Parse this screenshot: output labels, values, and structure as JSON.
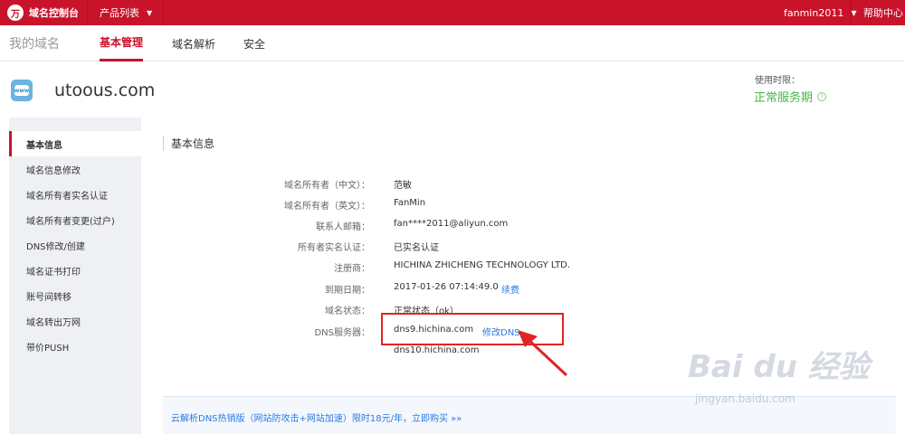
{
  "topbar": {
    "logo_text": "域名控制台",
    "products_label": "产品列表",
    "username": "fanmin2011",
    "help_label": "帮助中心"
  },
  "nav": {
    "title": "我的域名",
    "tabs": [
      {
        "label": "基本管理",
        "active": true
      },
      {
        "label": "域名解析",
        "active": false
      },
      {
        "label": "安全",
        "active": false
      }
    ]
  },
  "domain": {
    "icon_label": "www",
    "name": "utoous.com",
    "term_label": "使用时限：",
    "term_status": "正常服务期",
    "term_help": "?"
  },
  "sidebar": {
    "items": [
      {
        "label": "基本信息",
        "active": true
      },
      {
        "label": "域名信息修改"
      },
      {
        "label": "域名所有者实名认证"
      },
      {
        "label": "域名所有者变更(过户)"
      },
      {
        "label": "DNS修改/创建"
      },
      {
        "label": "域名证书打印"
      },
      {
        "label": "账号间转移"
      },
      {
        "label": "域名转出万网"
      },
      {
        "label": "带价PUSH"
      }
    ]
  },
  "info": {
    "section_title": "基本信息",
    "rows": [
      {
        "label": "域名所有者（中文）：",
        "value": "范敏"
      },
      {
        "label": "域名所有者（英文）：",
        "value": "FanMin"
      },
      {
        "label": "联系人邮箱：",
        "value": "fan****2011@aliyun.com"
      },
      {
        "label": "所有者实名认证：",
        "value": "已实名认证"
      },
      {
        "label": "注册商：",
        "value": "HICHINA ZHICHENG TECHNOLOGY LTD."
      },
      {
        "label": "到期日期：",
        "value": "2017-01-26 07:14:49.0",
        "link": "续费"
      },
      {
        "label": "域名状态：",
        "value": "正常状态（ok）"
      },
      {
        "label": "DNS服务器：",
        "value": "dns9.hichina.com",
        "link": "修改DNS"
      },
      {
        "label": "",
        "value": "dns10.hichina.com"
      }
    ]
  },
  "promo": {
    "text": "云解析DNS热销版（网站防攻击+网站加速）限时18元/年，立即购买 »»"
  },
  "watermark": {
    "text": "Bai du 经验",
    "url": "jingyan.baidu.com"
  },
  "colors": {
    "brand_red": "#c9132b",
    "link_blue": "#2a7ae2",
    "status_green": "#44b549",
    "highlight_red": "#e02424"
  }
}
